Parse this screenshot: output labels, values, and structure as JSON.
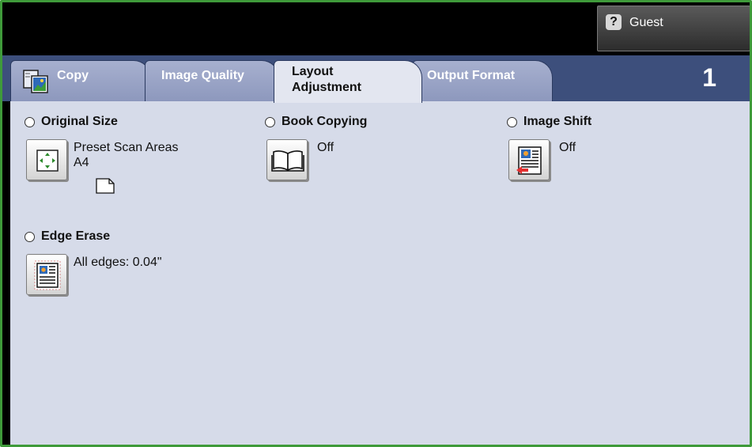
{
  "header": {
    "user_label": "Guest",
    "help_glyph": "?"
  },
  "tabs": [
    {
      "label": "Copy"
    },
    {
      "label": "Image Quality"
    },
    {
      "label_line1": "Layout",
      "label_line2": "Adjustment"
    },
    {
      "label": "Output Format"
    }
  ],
  "active_tab": "Layout Adjustment",
  "copy_count": "1",
  "features": {
    "original_size": {
      "title": "Original Size",
      "value_line1": "Preset Scan Areas",
      "value_line2": "A4",
      "icon": "scan-area-arrows-icon"
    },
    "book_copying": {
      "title": "Book Copying",
      "value": "Off",
      "icon": "open-book-icon"
    },
    "image_shift": {
      "title": "Image Shift",
      "value": "Off",
      "icon": "image-shift-icon"
    },
    "edge_erase": {
      "title": "Edge Erase",
      "value": "All edges: 0.04\"",
      "icon": "edge-erase-icon"
    }
  },
  "colors": {
    "frame_border": "#3f9a3a",
    "tab_strip": "#3d4f7c",
    "panel": "#d6dbe9",
    "inactive_tab": "#9aa4c6"
  }
}
